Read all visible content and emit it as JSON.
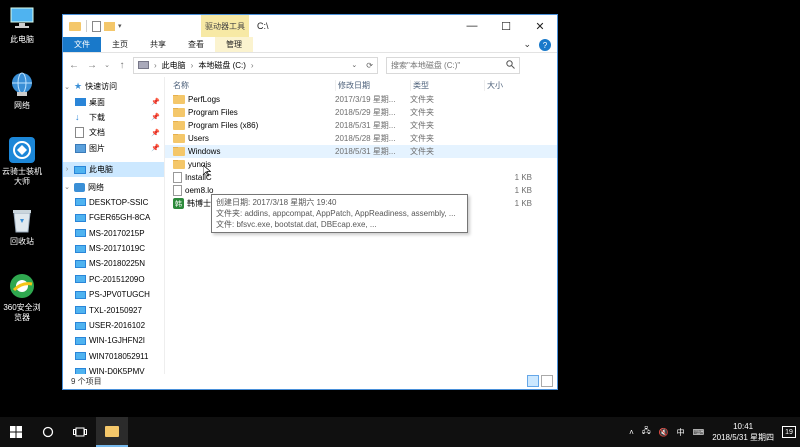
{
  "desktop": {
    "icons": [
      {
        "label": "此电脑",
        "icon": "this-pc-icon"
      },
      {
        "label": "网络",
        "icon": "network-icon"
      },
      {
        "label": "云骑士装机大师",
        "icon": "yunqishi-icon"
      },
      {
        "label": "回收站",
        "icon": "recycle-bin-icon"
      },
      {
        "label": "360安全浏览器",
        "icon": "360-browser-icon"
      }
    ]
  },
  "window": {
    "title": "C:\\",
    "tools_tab": "驱动器工具",
    "ribbon_tabs": [
      "文件",
      "主页",
      "共享",
      "查看",
      "管理"
    ],
    "address": {
      "seg1": "此电脑",
      "seg2": "本地磁盘 (C:)"
    },
    "search_placeholder": "搜索\"本地磁盘 (C:)\""
  },
  "nav_pane": {
    "quick_access": "快速访问",
    "quick_items": [
      "桌面",
      "下载",
      "文档",
      "图片"
    ],
    "this_pc": "此电脑",
    "network": "网络",
    "network_items": [
      "DESKTOP-SSIC",
      "FGER65GH-8CA",
      "MS-20170215P",
      "MS-20171019C",
      "MS-20180225N",
      "PC-20151209O",
      "PS-JPV0TUGCH",
      "TXL-20150927",
      "USER-2016102",
      "WIN-1GJHFN2I",
      "WIN7018052911",
      "WIN-D0K5PMV"
    ]
  },
  "file_list": {
    "headers": {
      "name": "名称",
      "date": "修改日期",
      "type": "类型",
      "size": "大小"
    },
    "rows": [
      {
        "name": "PerfLogs",
        "date": "2017/3/19 星期...",
        "type": "文件夹",
        "size": "",
        "kind": "folder"
      },
      {
        "name": "Program Files",
        "date": "2018/5/29 星期...",
        "type": "文件夹",
        "size": "",
        "kind": "folder"
      },
      {
        "name": "Program Files (x86)",
        "date": "2018/5/31 星期...",
        "type": "文件夹",
        "size": "",
        "kind": "folder"
      },
      {
        "name": "Users",
        "date": "2018/5/28 星期...",
        "type": "文件夹",
        "size": "",
        "kind": "folder"
      },
      {
        "name": "Windows",
        "date": "2018/5/31 星期...",
        "type": "文件夹",
        "size": "",
        "kind": "folder"
      },
      {
        "name": "yunqis",
        "date": "",
        "type": "",
        "size": "",
        "kind": "folder"
      },
      {
        "name": "InstallC",
        "date": "",
        "type": "",
        "size": "1 KB",
        "kind": "file"
      },
      {
        "name": "oem8.lo",
        "date": "",
        "type": "",
        "size": "1 KB",
        "kind": "file"
      },
      {
        "name": "韩博士驱动助理",
        "date": "2018/5/28 星期...",
        "type": "快捷方式",
        "size": "1 KB",
        "kind": "app"
      }
    ]
  },
  "tooltip": {
    "line1": "创建日期: 2017/3/18 星期六 19:40",
    "line2": "文件夹: addins, appcompat, AppPatch, AppReadiness, assembly, ...",
    "line3": "文件: bfsvc.exe, bootstat.dat, DBEcap.exe, ..."
  },
  "status": {
    "item_count": "9 个项目"
  },
  "taskbar": {
    "time": "10:41",
    "date": "2018/5/31 星期四",
    "ime": "中",
    "notifications": "19"
  },
  "colors": {
    "accent": "#1979ca",
    "selection": "#cce8ff",
    "tools_tab": "#f7e9a5"
  }
}
